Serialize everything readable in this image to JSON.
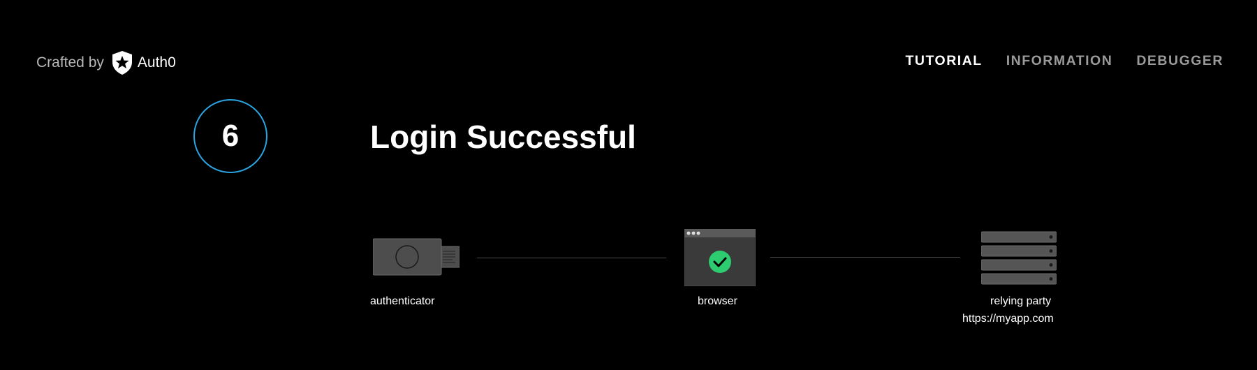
{
  "header": {
    "crafted_by": "Crafted by",
    "brand_name": "Auth0"
  },
  "nav": {
    "items": [
      {
        "label": "TUTORIAL",
        "active": true
      },
      {
        "label": "INFORMATION",
        "active": false
      },
      {
        "label": "DEBUGGER",
        "active": false
      }
    ]
  },
  "step": {
    "number": "6",
    "title": "Login Successful"
  },
  "diagram": {
    "authenticator_label": "authenticator",
    "browser_label": "browser",
    "relying_party_label": "relying party",
    "relying_party_url": "https://myapp.com",
    "icons": {
      "authenticator": "security-key-icon",
      "browser": "browser-window-check-icon",
      "relying_party": "server-rack-icon"
    }
  },
  "colors": {
    "background": "#000000",
    "accent_circle": "#2aa3e0",
    "success": "#2ecc71",
    "nav_inactive": "#9a9a9a",
    "device_gray": "#555555"
  }
}
